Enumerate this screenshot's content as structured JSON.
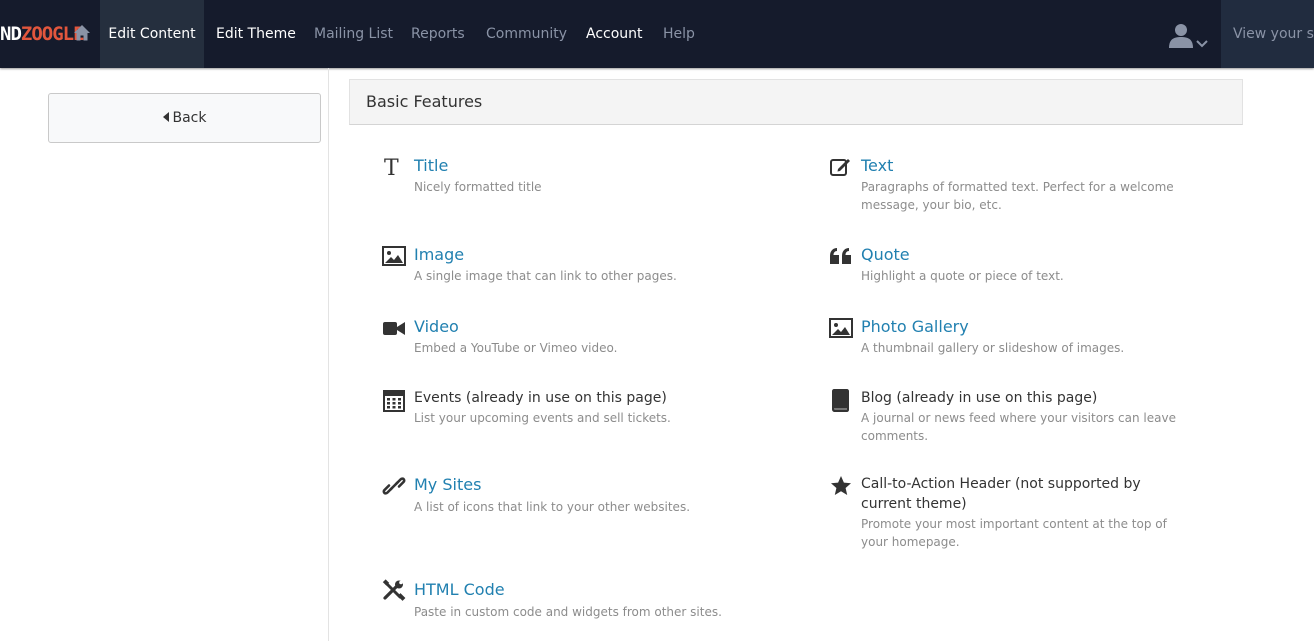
{
  "brand": {
    "part1": "ND",
    "part2": "ZOOGLE",
    "part1_color": "#ffffff",
    "part2_color": "#e2563d"
  },
  "nav": {
    "items": [
      {
        "label": "Edit Content"
      },
      {
        "label": "Edit Theme"
      },
      {
        "label": "Mailing List"
      },
      {
        "label": "Reports"
      },
      {
        "label": "Community"
      },
      {
        "label": "Account"
      },
      {
        "label": "Help"
      }
    ],
    "view_site": "View your site"
  },
  "sidebar": {
    "back_label": "Back"
  },
  "panel": {
    "title": "Basic Features"
  },
  "features": [
    {
      "icon": "title-icon",
      "title": "Title",
      "desc": "Nicely formatted title"
    },
    {
      "icon": "text-edit-icon",
      "title": "Text",
      "desc": "Paragraphs of formatted text. Perfect for a welcome message, your bio, etc."
    },
    {
      "icon": "image-icon",
      "title": "Image",
      "desc": "A single image that can link to other pages."
    },
    {
      "icon": "quote-icon",
      "title": "Quote",
      "desc": "Highlight a quote or piece of text."
    },
    {
      "icon": "video-icon",
      "title": "Video",
      "desc": "Embed a YouTube or Vimeo video."
    },
    {
      "icon": "photo-gallery-icon",
      "title": "Photo Gallery",
      "desc": "A thumbnail gallery or slideshow of images."
    },
    {
      "icon": "calendar-icon",
      "title": "Events (already in use on this page)",
      "desc": "List your upcoming events and sell tickets."
    },
    {
      "icon": "book-icon",
      "title": "Blog (already in use on this page)",
      "desc": "A journal or news feed where your visitors can leave comments."
    },
    {
      "icon": "link-icon",
      "title": "My Sites",
      "desc": "A list of icons that link to your other websites."
    },
    {
      "icon": "star-icon",
      "title": "Call-to-Action Header (not supported by current theme)",
      "desc": "Promote your most important content at the top of your homepage."
    },
    {
      "icon": "tools-icon",
      "title": "HTML Code",
      "desc": "Paste in custom code and widgets from other sites."
    }
  ],
  "colors": {
    "topbar": "#151b2c",
    "link": "#2180b0",
    "muted": "#8c8c8c"
  }
}
